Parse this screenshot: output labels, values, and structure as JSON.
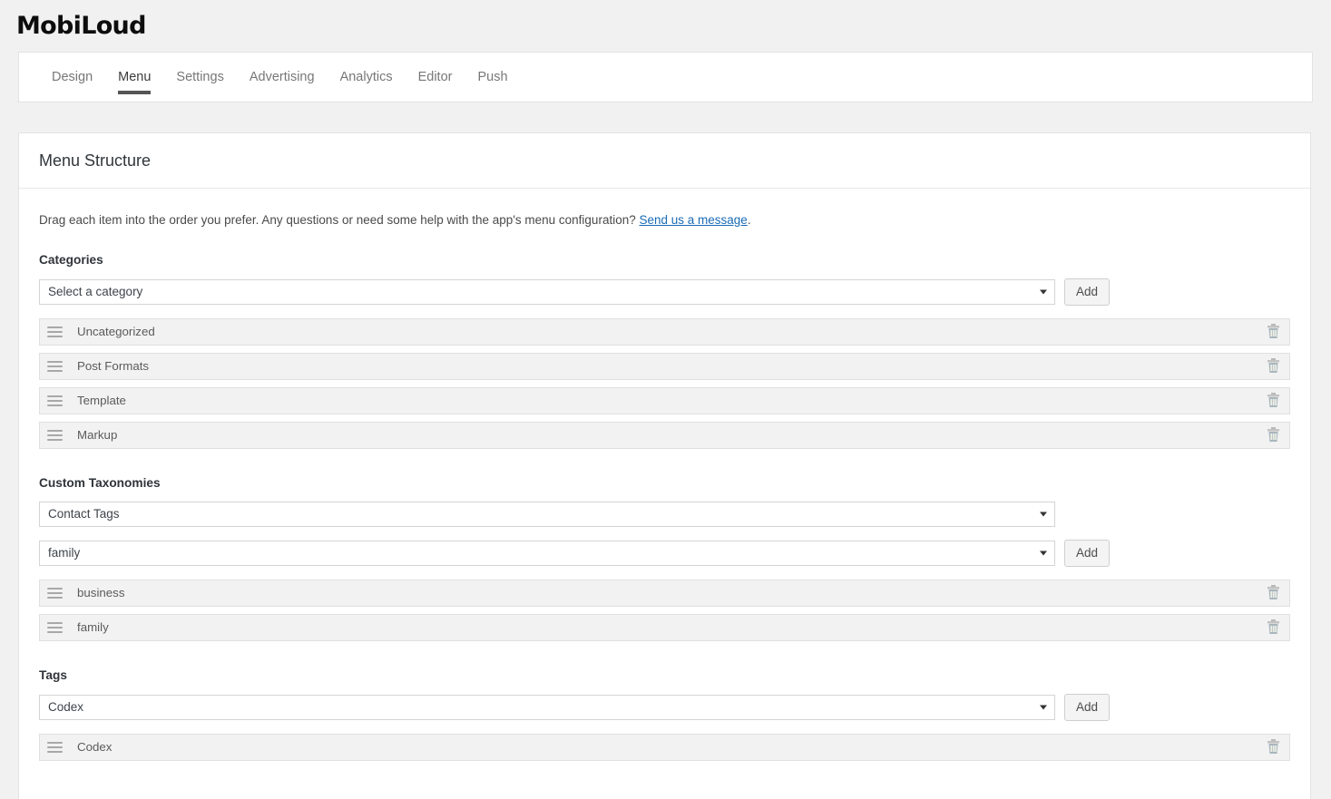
{
  "brand": {
    "name": "MobiLoud"
  },
  "tabs": [
    {
      "label": "Design",
      "active": false
    },
    {
      "label": "Menu",
      "active": true
    },
    {
      "label": "Settings",
      "active": false
    },
    {
      "label": "Advertising",
      "active": false
    },
    {
      "label": "Analytics",
      "active": false
    },
    {
      "label": "Editor",
      "active": false
    },
    {
      "label": "Push",
      "active": false
    }
  ],
  "panel": {
    "title": "Menu Structure",
    "intro_before_link": "Drag each item into the order you prefer. Any questions or need some help with the app's menu configuration? ",
    "intro_link": "Send us a message",
    "intro_after_link": "."
  },
  "categories": {
    "label": "Categories",
    "select_value": "Select a category",
    "add_label": "Add",
    "items": [
      {
        "label": "Uncategorized"
      },
      {
        "label": "Post Formats"
      },
      {
        "label": "Template"
      },
      {
        "label": "Markup"
      }
    ]
  },
  "custom_taxonomies": {
    "label": "Custom Taxonomies",
    "taxonomy_select_value": "Contact Tags",
    "term_select_value": "family",
    "add_label": "Add",
    "items": [
      {
        "label": "business"
      },
      {
        "label": "family"
      }
    ]
  },
  "tags": {
    "label": "Tags",
    "select_value": "Codex",
    "add_label": "Add",
    "items": [
      {
        "label": "Codex"
      }
    ]
  },
  "colors": {
    "page_bg": "#f1f1f1",
    "panel_bg": "#ffffff",
    "link": "#1a6bb5",
    "active_tab_underline": "#555555",
    "row_bg": "#f2f2f2"
  }
}
